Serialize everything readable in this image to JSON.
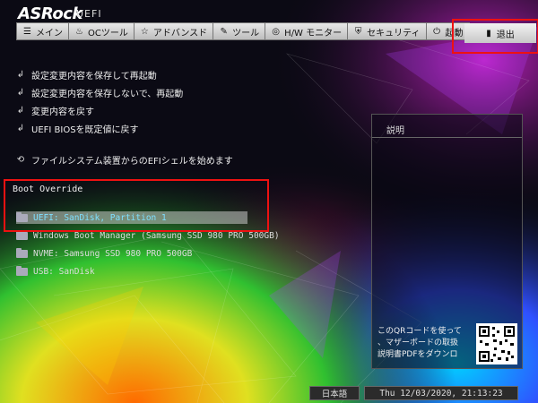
{
  "header": {
    "brand": "ASRock",
    "subtitle": "UEFI"
  },
  "tabs": [
    {
      "label": "メイン",
      "icon": "list-icon"
    },
    {
      "label": "OCツール",
      "icon": "flame-icon"
    },
    {
      "label": "アドバンスド",
      "icon": "star-icon"
    },
    {
      "label": "ツール",
      "icon": "wrench-icon"
    },
    {
      "label": "H/W モニター",
      "icon": "monitor-icon"
    },
    {
      "label": "セキュリティ",
      "icon": "shield-icon"
    },
    {
      "label": "起動",
      "icon": "power-icon"
    }
  ],
  "active_tab": {
    "label": "退出",
    "icon": "exit-door-icon"
  },
  "exit_menu": [
    "設定変更内容を保存して再起動",
    "設定変更内容を保存しないで、再起動",
    "変更内容を戻す",
    "UEFI BIOSを既定値に戻す",
    "ファイルシステム装置からのEFIシェルを始めます"
  ],
  "boot_override": {
    "label": "Boot Override",
    "items": [
      "UEFI: SanDisk, Partition 1",
      "Windows Boot Manager (Samsung SSD 980 PRO 500GB)",
      "NVME: Samsung SSD 980 PRO 500GB",
      "USB: SanDisk"
    ],
    "selected_index": 0
  },
  "description_panel": {
    "title": "説明",
    "qr_text": "このQRコードを使って\n、マザーボードの取扱\n説明書PDFをダウンロ"
  },
  "footer": {
    "language": "日本語",
    "datetime": "Thu 12/03/2020, 21:13:23"
  },
  "colors": {
    "highlight_text": "#7fe0ff",
    "annotation_red": "#e11111"
  }
}
